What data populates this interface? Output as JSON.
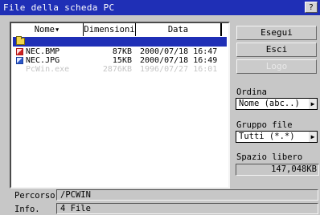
{
  "window": {
    "title": "File della scheda PC",
    "help_label": "?"
  },
  "file_list": {
    "columns": [
      "Nome▾",
      "Dimensioni",
      "Data"
    ],
    "selected_icon": "folder-icon",
    "rows": [
      {
        "icon": "bmp-file-icon",
        "name": "NEC.BMP",
        "size": "87KB",
        "date": "2000/07/18 16:47",
        "enabled": true
      },
      {
        "icon": "jpg-file-icon",
        "name": "NEC.JPG",
        "size": "15KB",
        "date": "2000/07/18 16:49",
        "enabled": true
      },
      {
        "icon": "",
        "name": "PcWin.exe",
        "size": "2876KB",
        "date": "1996/07/27 16:01",
        "enabled": false
      }
    ]
  },
  "buttons": {
    "run": "Esegui",
    "exit": "Esci",
    "logo": "Logo"
  },
  "sort": {
    "label": "Ordina",
    "value": "Nome (abc..)"
  },
  "file_group": {
    "label": "Gruppo file",
    "value": "Tutti (*.*)"
  },
  "free_space": {
    "label": "Spazio libero",
    "value": "147,048KB"
  },
  "info": {
    "path_label": "Percorso",
    "path_value": "/PCWIN",
    "info_label": "Info.",
    "info_value": "4 File"
  },
  "colors": {
    "titlebar": "#1f2fb6",
    "selection": "#1f2fb6",
    "panel": "#c7c7c7"
  }
}
